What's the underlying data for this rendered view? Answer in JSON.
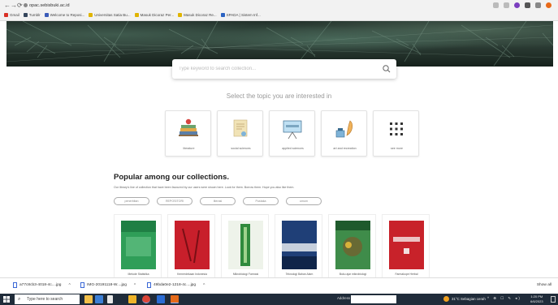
{
  "browser": {
    "url": "opac.sebisbuki.ac.id",
    "bookmarks": [
      {
        "label": "Gmail",
        "color": "#d93025"
      },
      {
        "label": "Tumblr",
        "color": "#35465c"
      },
      {
        "label": "Welcome to Reposi...",
        "color": "#3a5bb8"
      },
      {
        "label": "Universitas Satia Bu...",
        "color": "#e0b400"
      },
      {
        "label": "Masuk Dicoraz Per...",
        "color": "#e0b400"
      },
      {
        "label": "Masuk Dicoraz Re...",
        "color": "#e0b400"
      },
      {
        "label": "SPADA | Sistem Inf...",
        "color": "#2b63c2"
      }
    ]
  },
  "search": {
    "placeholder": "Type keyword to search collection..."
  },
  "topics": {
    "heading": "Select the topic you are interested in",
    "items": [
      {
        "label": "literature",
        "icon": "books-apple-icon"
      },
      {
        "label": "social sciences",
        "icon": "certificate-scroll-icon"
      },
      {
        "label": "applied sciences",
        "icon": "presentation-board-icon"
      },
      {
        "label": "art and recreation",
        "icon": "ink-feather-icon"
      },
      {
        "label": "see more",
        "icon": "grid-dots-icon"
      }
    ]
  },
  "popular": {
    "title": "Popular among our collections.",
    "subtitle": "Our library's line of collection that have been favoured by our users were shown here. Look for them. Borrow them. Hope you also like them.",
    "chips": [
      "penerbitan",
      "REPOSITORI",
      "literasi",
      "Pustaka",
      "umum"
    ],
    "books": [
      {
        "caption": "Metode Statistika",
        "color": "#2f9e58"
      },
      {
        "caption": "Kemerdekaan Indonesia",
        "color": "#c81f2b"
      },
      {
        "caption": "Mikrobiologi Farmasi",
        "color": "#2f8a3c"
      },
      {
        "caption": "Teknologi Bahan Alam",
        "color": "#1f3f77"
      },
      {
        "caption": "Buku ajar mikrobiologi",
        "color": "#3f8c4a"
      },
      {
        "caption": "Farmakope Herbal",
        "color": "#c8222a"
      }
    ]
  },
  "downloads": {
    "items": [
      "a77c8cb3-4018-4c....jpg",
      "IMG-20191118-W....jpg",
      "49bda0e2-1218-4c....jpg"
    ],
    "show_all": "Show all"
  },
  "taskbar": {
    "search_placeholder": "Type here to search",
    "address_label": "Address",
    "weather": "31°C  Sebagian cerah",
    "tray": "^ ⊕ ☐ ✎ ◂)",
    "time": "1:20 PM",
    "date": "6/6/2023"
  }
}
